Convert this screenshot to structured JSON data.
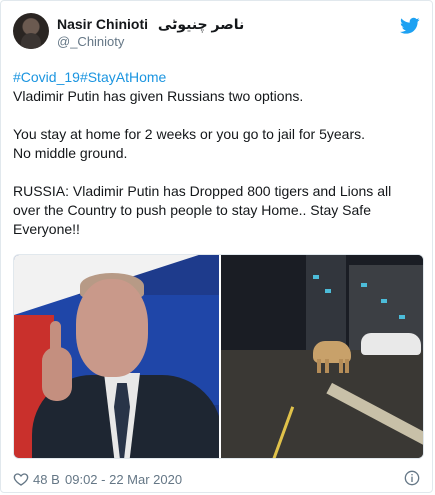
{
  "author": {
    "name": "Nasir Chinioti",
    "name_urdu": "ناصر چنیوٹی",
    "handle": "@_Chinioty"
  },
  "tweet": {
    "hashtags": "#Covid_19#StayAtHome",
    "line1": "Vladimir Putin has given Russians two options.",
    "line2": "You stay at home for 2 weeks or you go to jail for 5years.",
    "line3": "No middle ground.",
    "line4": "RUSSIA: Vladimir Putin has Dropped 800 tigers and Lions all over the Country to push people to stay Home.. Stay Safe Everyone!!"
  },
  "footer": {
    "likes": "48 B",
    "timestamp": "09:02 - 22 Mar 2020"
  },
  "icons": {
    "brand": "twitter-bird-icon",
    "like": "heart-icon",
    "info": "info-icon"
  },
  "colors": {
    "link": "#1b95e0",
    "brand": "#1da1f2",
    "muted": "#657786"
  }
}
